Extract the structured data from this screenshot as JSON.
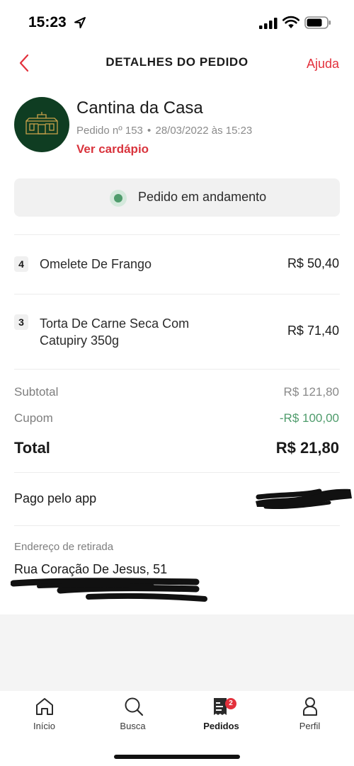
{
  "status_bar": {
    "time": "15:23"
  },
  "header": {
    "title": "DETALHES DO PEDIDO",
    "help": "Ajuda"
  },
  "restaurant": {
    "name": "Cantina da Casa",
    "order_number": "Pedido nº 153",
    "order_date": "28/03/2022 às 15:23",
    "view_menu": "Ver cardápio"
  },
  "status": {
    "text": "Pedido em andamento",
    "dot_color": "#4f9c6c"
  },
  "items": [
    {
      "qty": "4",
      "name": "Omelete De Frango",
      "price": "R$ 50,40"
    },
    {
      "qty": "3",
      "name_line1": "Torta De Carne Seca Com",
      "name_line2": "Catupiry 350g",
      "price": "R$ 71,40"
    }
  ],
  "totals": {
    "subtotal_label": "Subtotal",
    "subtotal_value": "R$ 121,80",
    "coupon_label": "Cupom",
    "coupon_value": "-R$ 100,00",
    "total_label": "Total",
    "total_value": "R$ 21,80"
  },
  "payment": {
    "label": "Pago pelo app"
  },
  "pickup": {
    "label": "Endereço de retirada",
    "address": "Rua Coração De Jesus, 51"
  },
  "bottom_nav": [
    {
      "label": "Início",
      "icon": "home-icon"
    },
    {
      "label": "Busca",
      "icon": "search-icon"
    },
    {
      "label": "Pedidos",
      "icon": "orders-icon",
      "badge": "2"
    },
    {
      "label": "Perfil",
      "icon": "user-icon"
    }
  ],
  "colors": {
    "accent": "#e3313c",
    "green": "#4f9c6c",
    "logo_bg": "#0f3d22",
    "logo_gold": "#c9a24a"
  }
}
